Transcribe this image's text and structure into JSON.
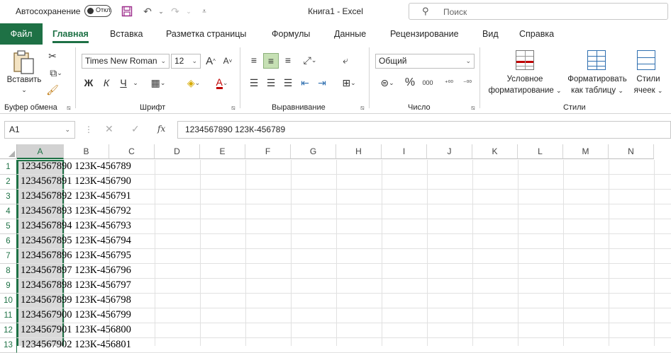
{
  "titlebar": {
    "autosave_label": "Автосохранение",
    "autosave_state": "Откл.",
    "doc_title": "Книга1  -  Excel",
    "search_placeholder": "Поиск"
  },
  "tabs": [
    {
      "label": "Файл"
    },
    {
      "label": "Главная"
    },
    {
      "label": "Вставка"
    },
    {
      "label": "Разметка страницы"
    },
    {
      "label": "Формулы"
    },
    {
      "label": "Данные"
    },
    {
      "label": "Рецензирование"
    },
    {
      "label": "Вид"
    },
    {
      "label": "Справка"
    }
  ],
  "ribbon": {
    "clipboard": {
      "paste_label": "Вставить",
      "group_label": "Буфер обмена"
    },
    "font": {
      "font_name": "Times New Roman",
      "font_size": "12",
      "bold": "Ж",
      "italic": "К",
      "underline": "Ч",
      "group_label": "Шрифт"
    },
    "alignment": {
      "group_label": "Выравнивание"
    },
    "number": {
      "format": "Общий",
      "group_label": "Число"
    },
    "styles": {
      "cond_format_line1": "Условное",
      "cond_format_line2": "форматирование",
      "format_table_line1": "Форматировать",
      "format_table_line2": "как таблицу",
      "cell_styles_line1": "Стили",
      "cell_styles_line2": "ячеек",
      "group_label": "Стили"
    }
  },
  "formula_bar": {
    "name_box": "A1",
    "formula": "1234567890 123К-456789"
  },
  "grid": {
    "columns": [
      "A",
      "B",
      "C",
      "D",
      "E",
      "F",
      "G",
      "H",
      "I",
      "J",
      "K",
      "L",
      "M",
      "N"
    ],
    "rows": [
      {
        "num": "1",
        "value": "1234567890 123К-456789"
      },
      {
        "num": "2",
        "value": "1234567891 123К-456790"
      },
      {
        "num": "3",
        "value": "1234567892 123К-456791"
      },
      {
        "num": "4",
        "value": "1234567893 123К-456792"
      },
      {
        "num": "5",
        "value": "1234567894 123К-456793"
      },
      {
        "num": "6",
        "value": "1234567895 123К-456794"
      },
      {
        "num": "7",
        "value": "1234567896 123К-456795"
      },
      {
        "num": "8",
        "value": "1234567897 123К-456796"
      },
      {
        "num": "9",
        "value": "1234567898 123К-456797"
      },
      {
        "num": "10",
        "value": "1234567899 123К-456798"
      },
      {
        "num": "11",
        "value": "1234567900 123К-456799"
      },
      {
        "num": "12",
        "value": "1234567901 123К-456800"
      },
      {
        "num": "13",
        "value": "1234567902 123К-456801"
      }
    ]
  },
  "colors": {
    "accent": "#1e7145",
    "selection_fill": "#d9d9d9"
  }
}
